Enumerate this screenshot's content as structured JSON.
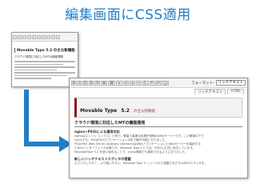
{
  "slide_title": "編集画面にCSS適用",
  "before_window": {
    "heading": "Movable Type 5.2 の主な新機能",
    "subheading": "クラウド環境に対応したMTの機能開発"
  },
  "after_window": {
    "toolbar_buttons": [
      "B",
      "I",
      "U",
      "S",
      "A",
      "⌘",
      "⛓",
      "≡",
      "≡",
      "≡",
      "•",
      "1.",
      "❝",
      "⤺",
      "⤻"
    ],
    "format_label": "フォーマット:",
    "format_value": "リッチテキスト",
    "tabs": [
      "リッチテキスト",
      "HTML"
    ],
    "heading_main": "Movable Type",
    "heading_version": "5.2",
    "heading_suffix": "の主な新機能",
    "section_heading": "クラウド環境に対応したMTの機能開発",
    "subsection_1": "nginx+PSGIによる運用対応",
    "para_1": [
      "nginxはエンジン エックス」と呼び、軽量で高速な処理が特徴のWebサーバーです。この環境の下で",
      "nginxでも、MTはPSGIアプリケーションの形で動作可能になりました。",
      "PSGI(Perl Web Server Gateway Interface)はWebアプリケーションとWebサーバーを接続する",
      "ためのインターフェイス仕様です。Movable Type 5.2 では、PSGIに正式に対応しています。",
      "MovableType 5.2 を使い始めることで、nginx環境でも運用できるようになりました。"
    ],
    "subsection_2": "新しいリッチテキストエディタの搭載",
    "para_2": [
      "より入力しやすく、より使いやすい、Movable Type 5 シリーズから搭載されたTinyMCEエディタを、"
    ]
  },
  "colors": {
    "title": "#1f7fc8",
    "arrow": "#1f7fc8",
    "heading_accent": "#8b1a1a"
  }
}
